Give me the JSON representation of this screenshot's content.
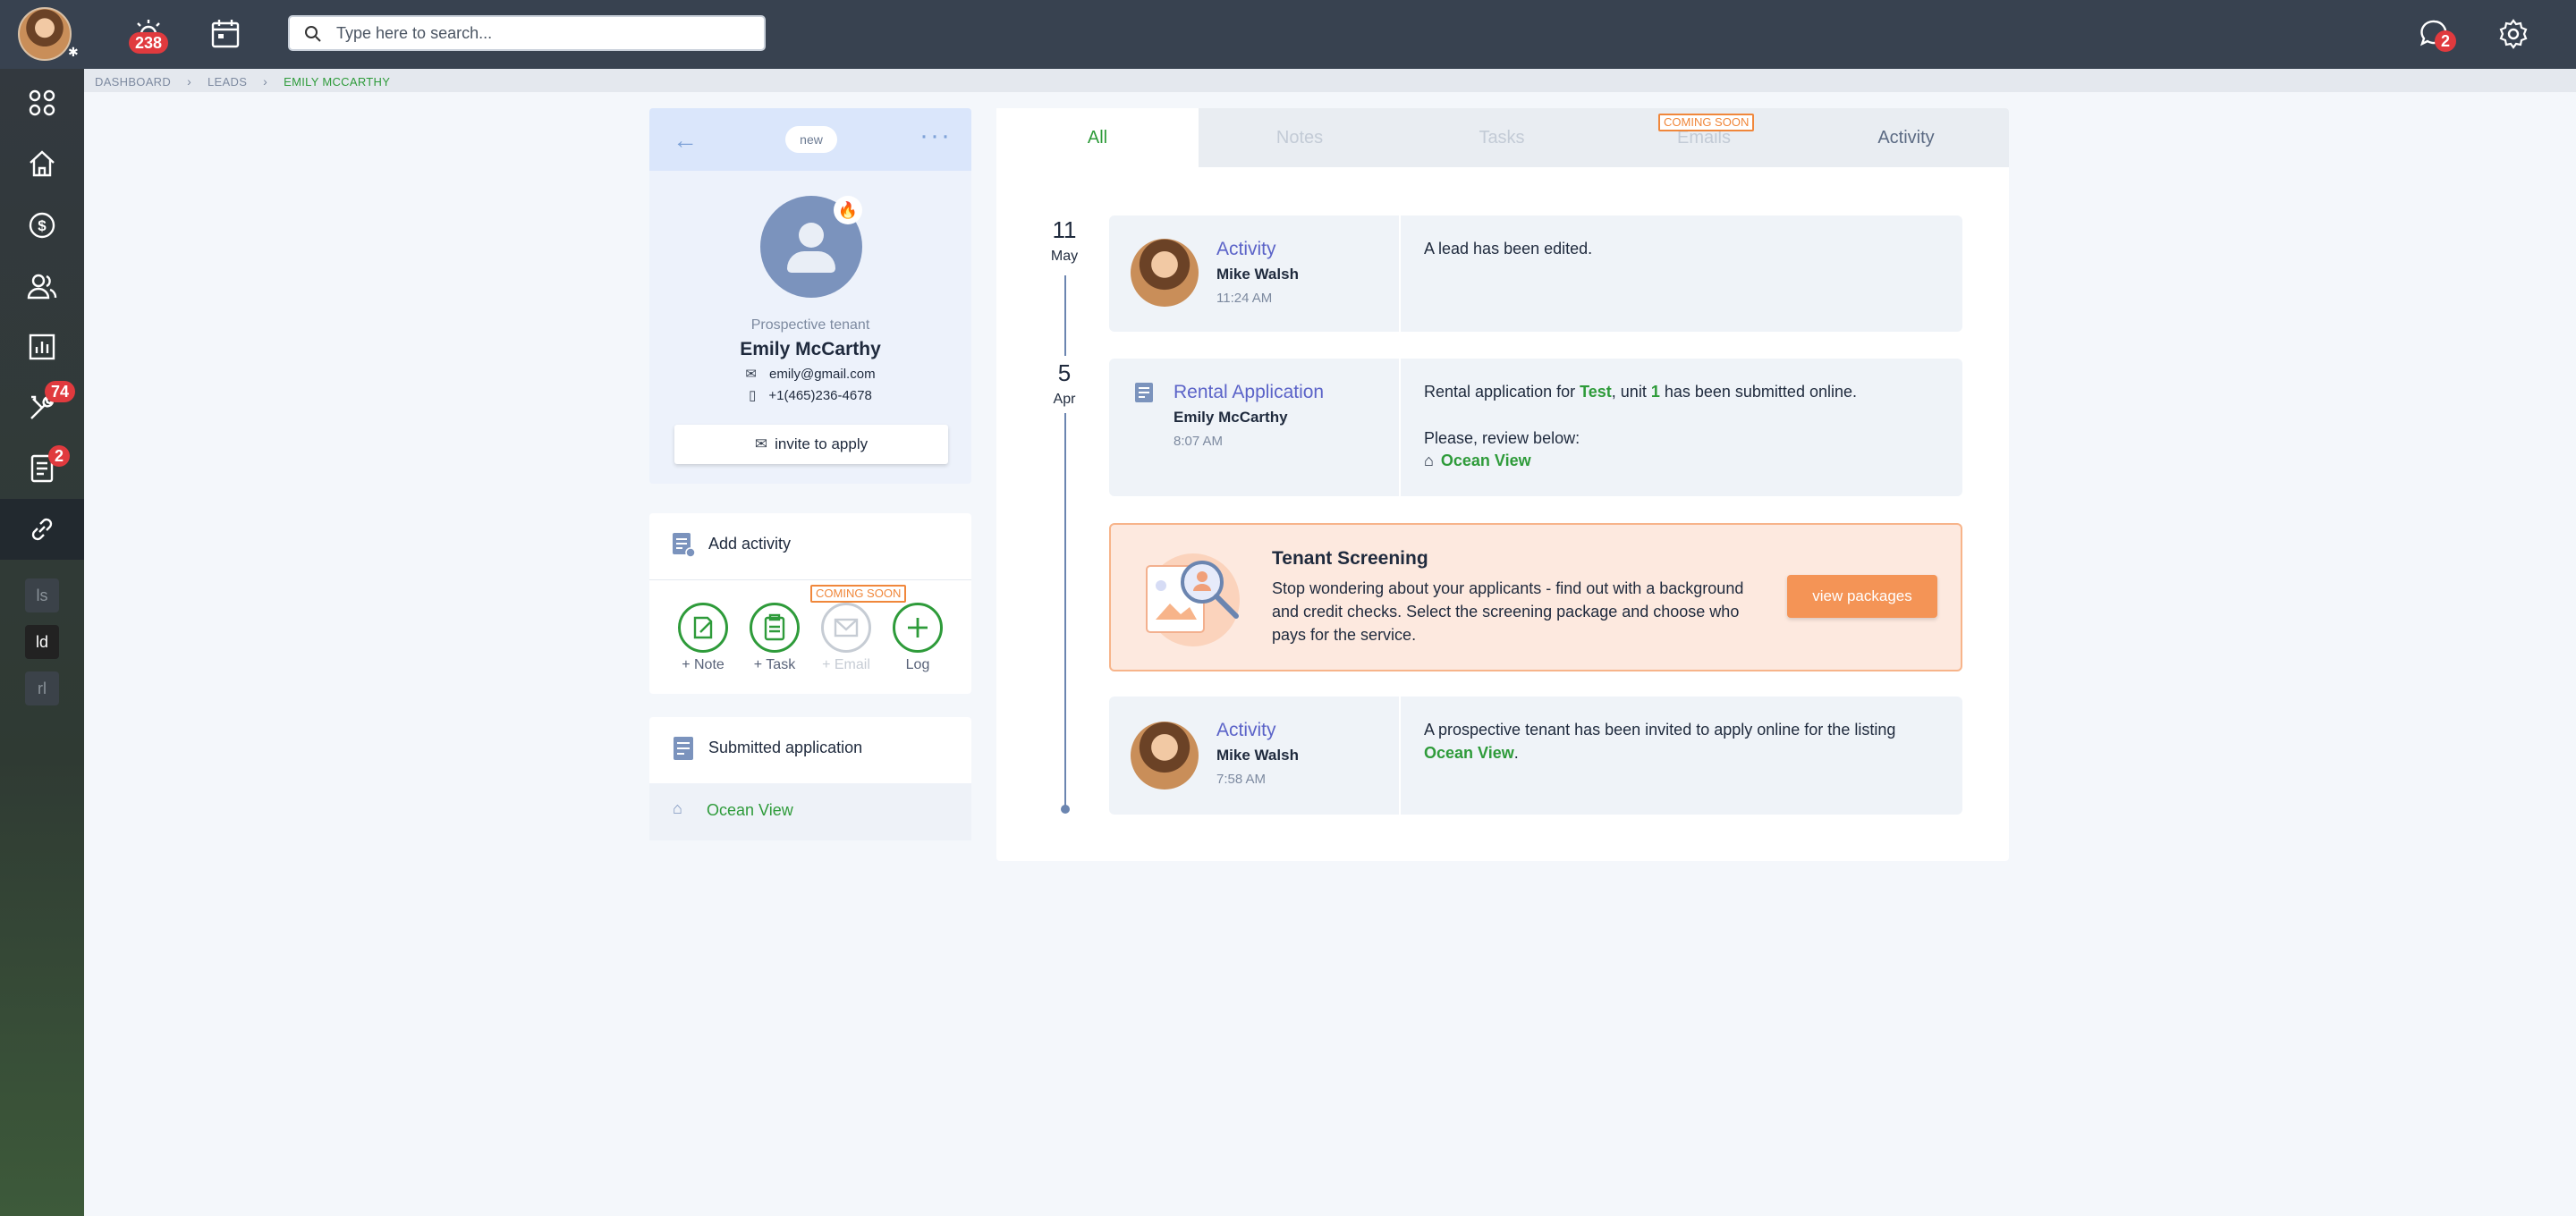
{
  "topbar": {
    "alerts_count": "238",
    "search_placeholder": "Type here to search...",
    "messages_count": "2"
  },
  "sidebar": {
    "maintenance_count": "74",
    "applications_count": "2",
    "mini_items": [
      "ls",
      "ld",
      "rl"
    ]
  },
  "breadcrumb": {
    "items": [
      "DASHBOARD",
      "LEADS",
      "EMILY MCCARTHY"
    ]
  },
  "lead": {
    "status_tag": "new",
    "role": "Prospective tenant",
    "name": "Emily McCarthy",
    "email": "emily@gmail.com",
    "phone": "+1(465)236-4678",
    "invite_label": "invite to apply"
  },
  "add_activity": {
    "title": "Add activity",
    "coming_soon": "COMING SOON",
    "actions": [
      "+ Note",
      "+ Task",
      "+ Email",
      "Log"
    ]
  },
  "submitted": {
    "title": "Submitted application",
    "property": "Ocean View"
  },
  "tabs": {
    "items": [
      "All",
      "Notes",
      "Tasks",
      "Emails",
      "Activity"
    ],
    "emails_badge": "COMING SOON"
  },
  "timeline": {
    "dates": [
      {
        "day": "11",
        "month": "May"
      },
      {
        "day": "5",
        "month": "Apr"
      }
    ],
    "entries": [
      {
        "kind": "Activity",
        "who": "Mike Walsh",
        "time": "11:24 AM",
        "text": "A lead has been edited."
      },
      {
        "kind": "Rental Application",
        "who": "Emily McCarthy",
        "time": "8:07 AM",
        "text_a": "Rental application for ",
        "text_property": "Test",
        "text_b": ", unit ",
        "text_unit": "1",
        "text_c": " has been submitted online.",
        "review": "Please, review below:",
        "property": "Ocean View"
      },
      {
        "kind": "Activity",
        "who": "Mike Walsh",
        "time": "7:58 AM",
        "text_a": "A prospective tenant has been invited to apply online for the listing ",
        "text_link": "Ocean View",
        "text_b": "."
      }
    ]
  },
  "screening": {
    "title": "Tenant Screening",
    "description": "Stop wondering about your applicants - find out with a background and credit checks. Select the screening package and choose who pays for the service.",
    "button": "view packages"
  },
  "colors": {
    "topbar": "#384250",
    "accent_green": "#2e9b3a",
    "accent_orange": "#f49456",
    "badge_red": "#e03a3e"
  }
}
